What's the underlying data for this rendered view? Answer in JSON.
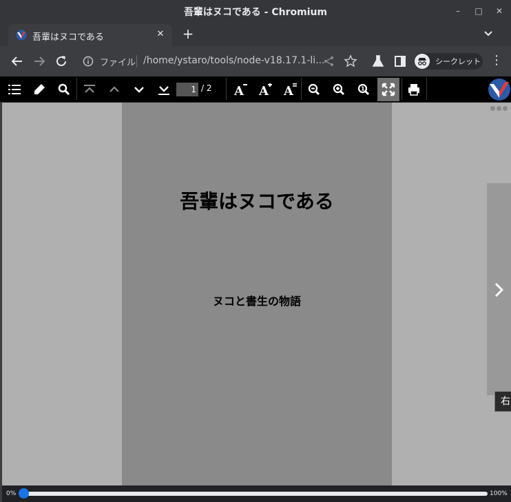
{
  "window": {
    "title": "吾輩はヌコである - Chromium"
  },
  "tab": {
    "title": "吾輩はヌコである"
  },
  "address": {
    "scheme_label": "ファイル",
    "url": "/home/ystaro/tools/node-v18.17.1-li..."
  },
  "incognito": {
    "label": "シークレット"
  },
  "pdf_toolbar": {
    "current_page": "1",
    "total_pages": "/ 2"
  },
  "document": {
    "title": "吾輩はヌコである",
    "subtitle": "ヌコと書生の物語"
  },
  "tooltip": {
    "text": "右"
  },
  "slider": {
    "min_label": "0%",
    "max_label": "100%",
    "value": 0
  },
  "colors": {
    "accent": "#1a73e8",
    "toolbar_bg": "#000000",
    "page_bg": "#8a8a8a",
    "viewer_bg": "#b0b0b0"
  }
}
